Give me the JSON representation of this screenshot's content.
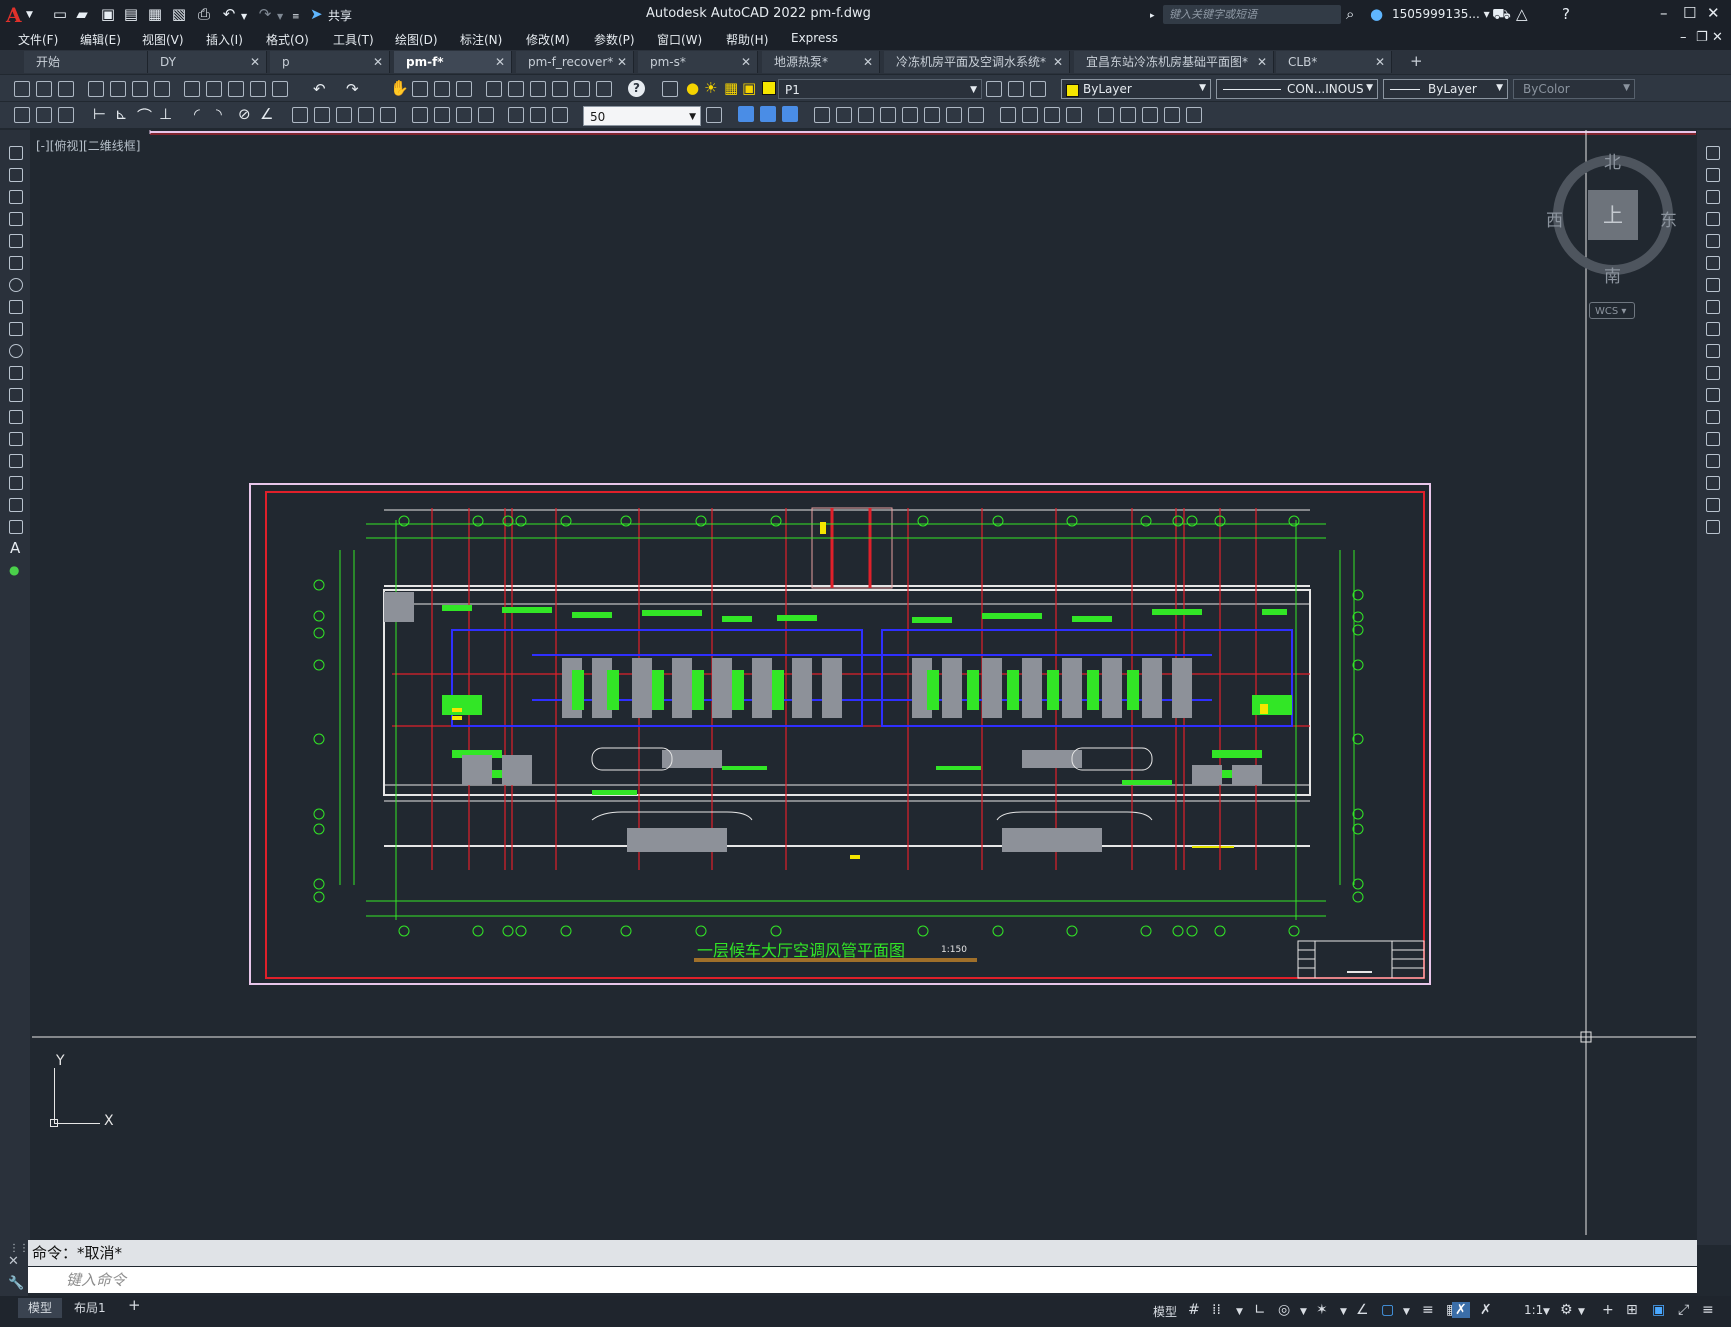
{
  "app": {
    "title": "Autodesk AutoCAD 2022    pm-f.dwg",
    "share_label": "共享",
    "search_placeholder": "键入关键字或短语",
    "user": "1505999135... ▾"
  },
  "menus": [
    "文件(F)",
    "编辑(E)",
    "视图(V)",
    "插入(I)",
    "格式(O)",
    "工具(T)",
    "绘图(D)",
    "标注(N)",
    "修改(M)",
    "参数(P)",
    "窗口(W)",
    "帮助(H)",
    "Express"
  ],
  "tabs": [
    {
      "label": "开始",
      "active": false
    },
    {
      "label": "DY",
      "active": false
    },
    {
      "label": "p",
      "active": false
    },
    {
      "label": "pm-f*",
      "active": true
    },
    {
      "label": "pm-f_recover*",
      "active": false
    },
    {
      "label": "pm-s*",
      "active": false
    },
    {
      "label": "地源热泵*",
      "active": false
    },
    {
      "label": "冷冻机房平面及空调水系统*",
      "active": false
    },
    {
      "label": "宜昌东站冷冻机房基础平面图*",
      "active": false
    },
    {
      "label": "CLB*",
      "active": false
    }
  ],
  "toolbar": {
    "layer": "P1",
    "color": "ByLayer",
    "linetype": "CON...INOUS",
    "lineweight": "ByLayer",
    "plotstyle": "ByColor",
    "dimscale": "50"
  },
  "viewport": {
    "label": "[-][俯视][二维线框]",
    "viewcube": {
      "north": "北",
      "south": "南",
      "west": "西",
      "east": "东",
      "top": "上"
    },
    "wcs": "WCS ▾",
    "ucs": {
      "x": "X",
      "y": "Y"
    }
  },
  "drawing": {
    "title": "一层候车大厅空调风管平面图",
    "scale": "1:150"
  },
  "command": {
    "history": "命令：*取消*",
    "placeholder": "键入命令"
  },
  "status": {
    "layouts": [
      "模型",
      "布局1"
    ],
    "model_button": "模型",
    "scale": "1:1"
  },
  "colors": {
    "accent_green": "#32e626",
    "frame_red": "#e0202a",
    "frame_magenta": "#e8c6ea",
    "canvas": "#212830",
    "duct_blue": "#2f2fff"
  }
}
